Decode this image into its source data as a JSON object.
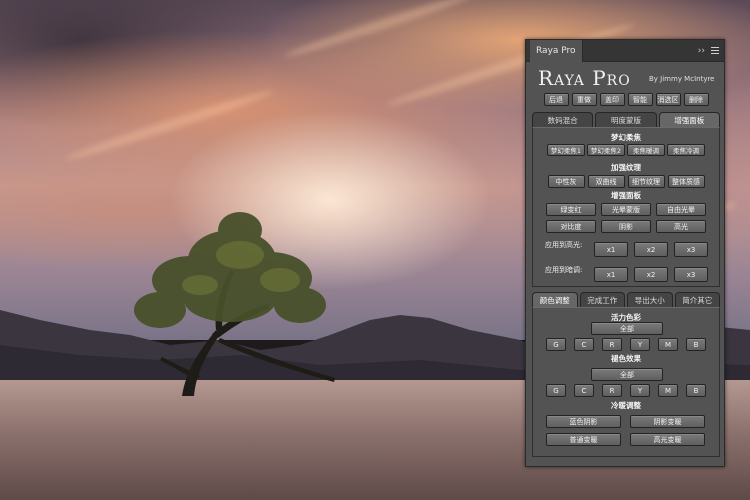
{
  "panel": {
    "tab_title": "Raya Pro",
    "collapse_glyph": "››",
    "logo": "Raya Pro",
    "byline": "By Jimmy McIntyre",
    "top_buttons": [
      "后退",
      "重做",
      "盖印",
      "智能",
      "消选区",
      "删除"
    ],
    "tabs_top": [
      {
        "label": "数码混合",
        "active": false
      },
      {
        "label": "明度蒙版",
        "active": false
      },
      {
        "label": "增强面板",
        "active": true
      }
    ],
    "dream_section": {
      "title": "梦幻柔焦",
      "buttons": [
        "梦幻柔焦1",
        "梦幻柔焦2",
        "柔焦暖调",
        "柔焦冷调"
      ]
    },
    "detail_section": {
      "title": "加强纹理",
      "buttons": [
        "中性灰",
        "双曲线",
        "细节纹理",
        "整体质感"
      ]
    },
    "enhance_section": {
      "title": "增强面板",
      "row1": [
        "绿变红",
        "光晕蒙版",
        "自由光晕"
      ],
      "row2": [
        "对比度",
        "阴影",
        "高光"
      ]
    },
    "apply_highlight": {
      "label": "应用到高光:",
      "buttons": [
        "x1",
        "x2",
        "x3"
      ]
    },
    "apply_shadow": {
      "label": "应用到暗调:",
      "buttons": [
        "x1",
        "x2",
        "x3"
      ]
    },
    "tabs_bottom": [
      {
        "label": "颜色调整",
        "active": true
      },
      {
        "label": "完成工作",
        "active": false
      },
      {
        "label": "导出大小",
        "active": false
      },
      {
        "label": "简介其它",
        "active": false
      }
    ],
    "vibrance_section": {
      "title": "活力色彩",
      "all": "全部",
      "channels": [
        "G",
        "C",
        "R",
        "Y",
        "M",
        "B"
      ]
    },
    "hue_section": {
      "title": "褪色效果",
      "all": "全部",
      "channels": [
        "G",
        "C",
        "R",
        "Y",
        "M",
        "B"
      ]
    },
    "warm_section": {
      "title": "冷暖调整",
      "row1": [
        "蓝色阴影",
        "阴影变暖"
      ],
      "row2": [
        "普通变暖",
        "高光变暖"
      ]
    }
  },
  "colors": {
    "panel_bg": "#535353",
    "titlebar_bg": "#353535",
    "button_bg": "#6a6a6a",
    "text": "#f2f2f2"
  }
}
